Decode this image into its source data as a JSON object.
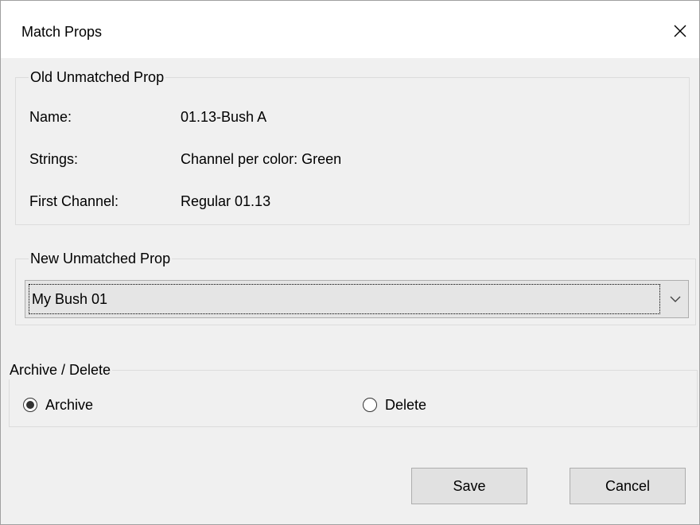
{
  "window": {
    "title": "Match Props",
    "close_icon": "close-icon"
  },
  "old_prop": {
    "legend": "Old Unmatched Prop",
    "fields": [
      {
        "label": "Name:",
        "value": "01.13-Bush A"
      },
      {
        "label": "Strings:",
        "value": "Channel per color: Green"
      },
      {
        "label": "First Channel:",
        "value": "Regular 01.13"
      }
    ]
  },
  "new_prop": {
    "legend": "New Unmatched Prop",
    "selected": "My Bush 01",
    "dropdown_icon": "chevron-down-icon"
  },
  "archive_delete": {
    "legend": "Archive / Delete",
    "options": [
      {
        "label": "Archive",
        "checked": true
      },
      {
        "label": "Delete",
        "checked": false
      }
    ]
  },
  "buttons": {
    "save": "Save",
    "cancel": "Cancel"
  }
}
